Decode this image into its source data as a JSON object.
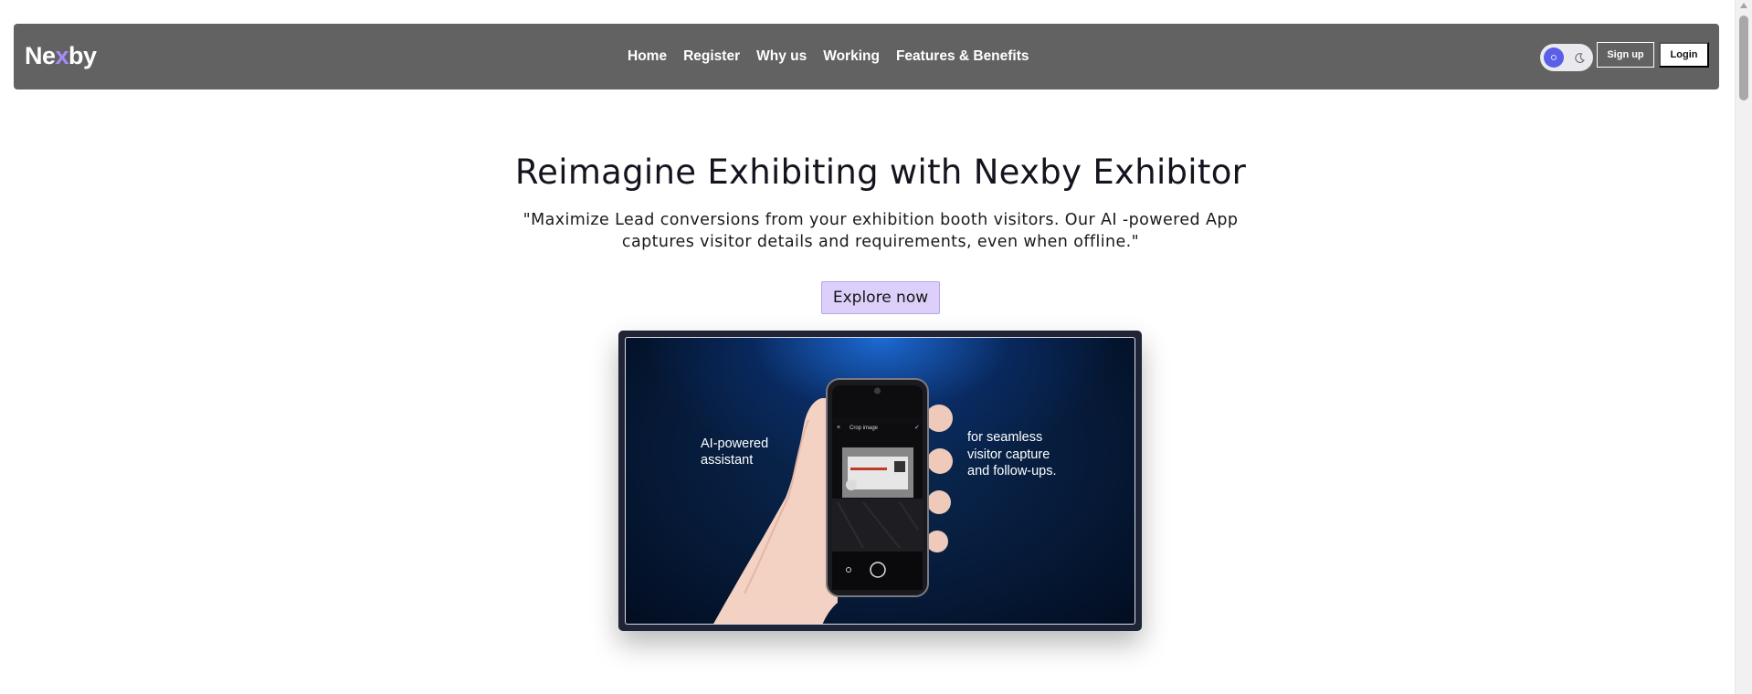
{
  "brand": {
    "logo_prefix": "Ne",
    "logo_x": "x",
    "logo_suffix": "by"
  },
  "nav": {
    "links": [
      {
        "label": "Home"
      },
      {
        "label": "Register"
      },
      {
        "label": "Why us"
      },
      {
        "label": "Working"
      },
      {
        "label": "Features & Benefits"
      }
    ],
    "theme_toggle": {
      "state": "light",
      "knob_icon": "sun-icon",
      "other_icon": "moon-icon"
    },
    "signup_label": "Sign up",
    "login_label": "Login"
  },
  "hero": {
    "title": "Reimagine Exhibiting with Nexby Exhibitor",
    "subtitle": "\"Maximize Lead conversions from your exhibition booth visitors. Our AI -powered App captures visitor details and requirements, even when offline.\"",
    "cta_label": "Explore now"
  },
  "media": {
    "caption_left": "AI-powered\nassistant",
    "caption_right": "for seamless\nvisitor capture\nand follow-ups.",
    "phone_screen_title": "Crop image"
  },
  "colors": {
    "navbar_bg": "#626262",
    "accent": "#5b5fe8",
    "cta_bg": "#dcd0fb",
    "logo_x": "#a78bfa",
    "media_frame": "#1f2536"
  }
}
